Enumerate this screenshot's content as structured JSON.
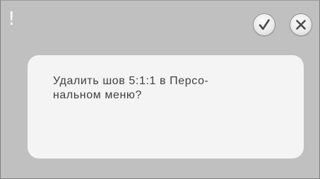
{
  "dialog": {
    "title_icon": "!",
    "message": "Удалить шов 5:1:1 в Персо-\nнальном меню?",
    "buttons": {
      "confirm_icon": "checkmark-icon",
      "close_icon": "close-icon"
    }
  },
  "colors": {
    "dialog_background": "#c0c0c0",
    "panel_background": "#f4f4f4",
    "text": "#3f3f3f",
    "icon_stroke": "#4a4a4a"
  }
}
